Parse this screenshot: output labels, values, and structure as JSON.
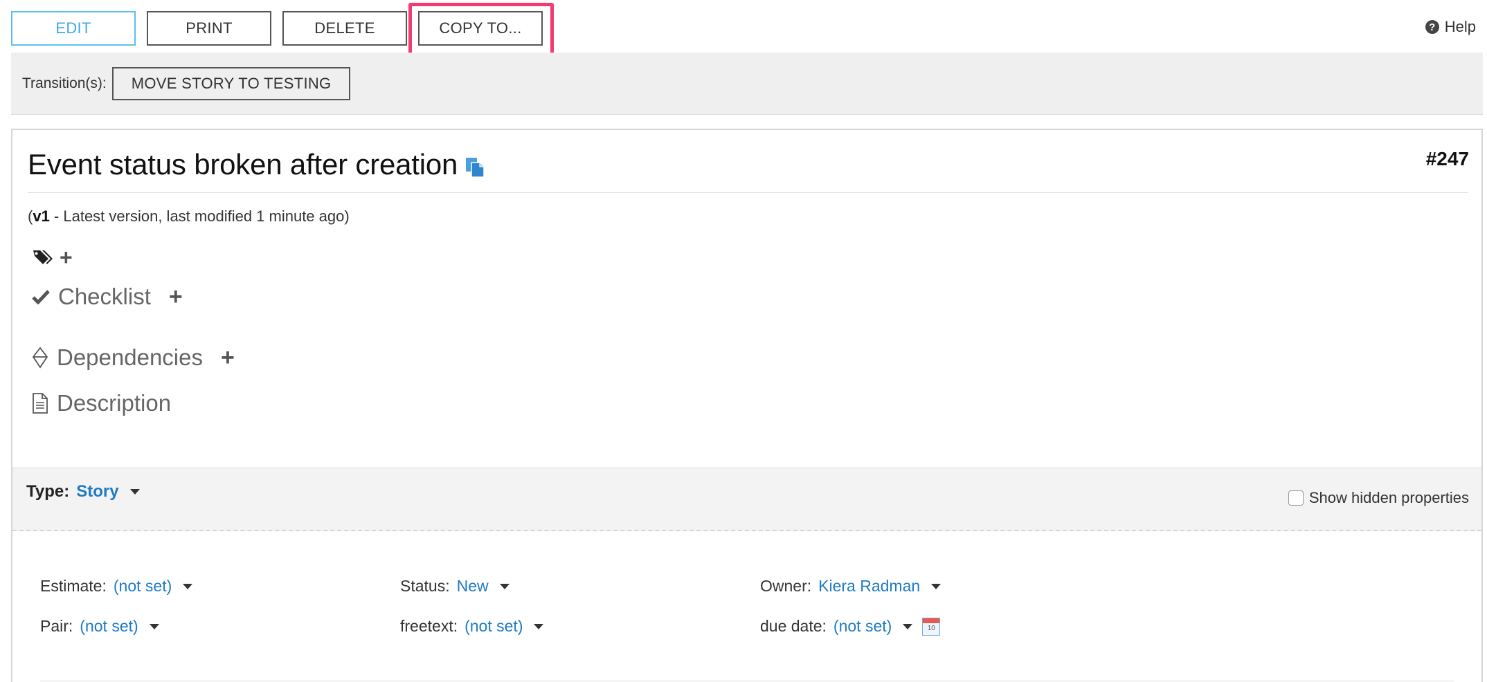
{
  "toolbar": {
    "edit_label": "EDIT",
    "print_label": "PRINT",
    "delete_label": "DELETE",
    "copy_label": "COPY TO...",
    "help_label": "Help",
    "highlight_color": "#f23b73"
  },
  "transitions": {
    "label": "Transition(s):",
    "move_button": "MOVE STORY TO TESTING"
  },
  "story": {
    "title": "Event status broken after creation",
    "number": "#247",
    "version_prefix": "(",
    "version_bold": "v1",
    "version_rest": " - Latest version, last modified 1 minute ago)"
  },
  "sections": {
    "checklist": "Checklist",
    "dependencies": "Dependencies",
    "description": "Description"
  },
  "type_bar": {
    "type_label": "Type:",
    "type_value": "Story",
    "show_hidden_label": "Show hidden properties"
  },
  "properties": {
    "estimate_label": "Estimate:",
    "estimate_value": "(not set)",
    "status_label": "Status:",
    "status_value": "New",
    "owner_label": "Owner:",
    "owner_value": "Kiera Radman",
    "pair_label": "Pair:",
    "pair_value": "(not set)",
    "freetext_label": "freetext:",
    "freetext_value": "(not set)",
    "duedate_label": "due date:",
    "duedate_value": "(not set)"
  },
  "colors": {
    "accent_blue": "#1f7ac4",
    "edit_blue": "#3fa9e0"
  }
}
